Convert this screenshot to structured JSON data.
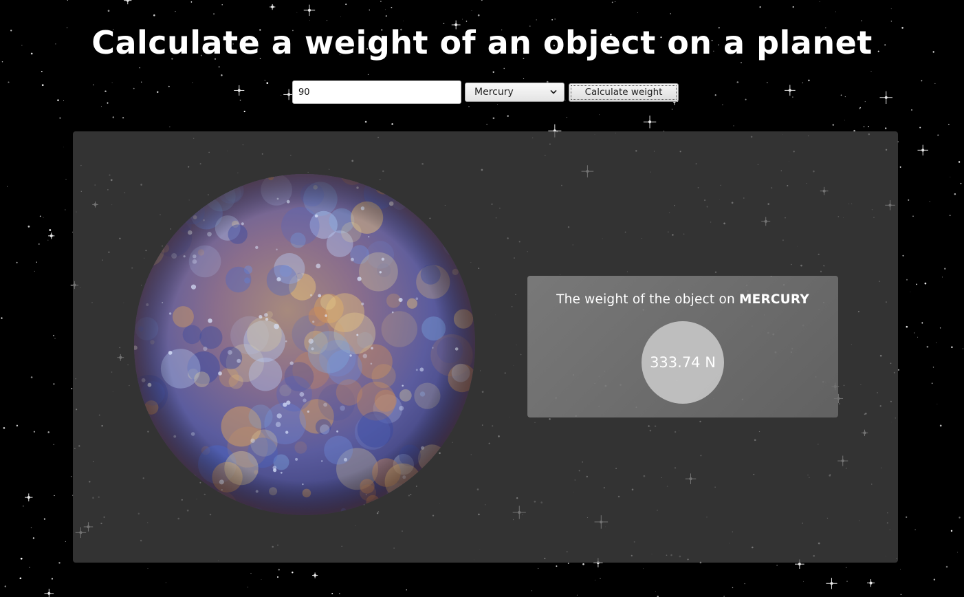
{
  "page": {
    "title": "Calculate a weight of an object on a planet"
  },
  "controls": {
    "mass_value": "90",
    "planet_selected": "Mercury",
    "calculate_label": "Calculate weight"
  },
  "result": {
    "prefix": "The weight of the object on ",
    "planet_name": "MERCURY",
    "weight": "333.74 N"
  },
  "colors": {
    "background": "#000000",
    "panel": "#464646",
    "result_box": "#8c8c8c",
    "result_circle": "#cdcdcd",
    "text": "#ffffff"
  },
  "icons": {
    "select_arrow": "chevron-down-icon",
    "planet": "mercury-planet-image"
  }
}
